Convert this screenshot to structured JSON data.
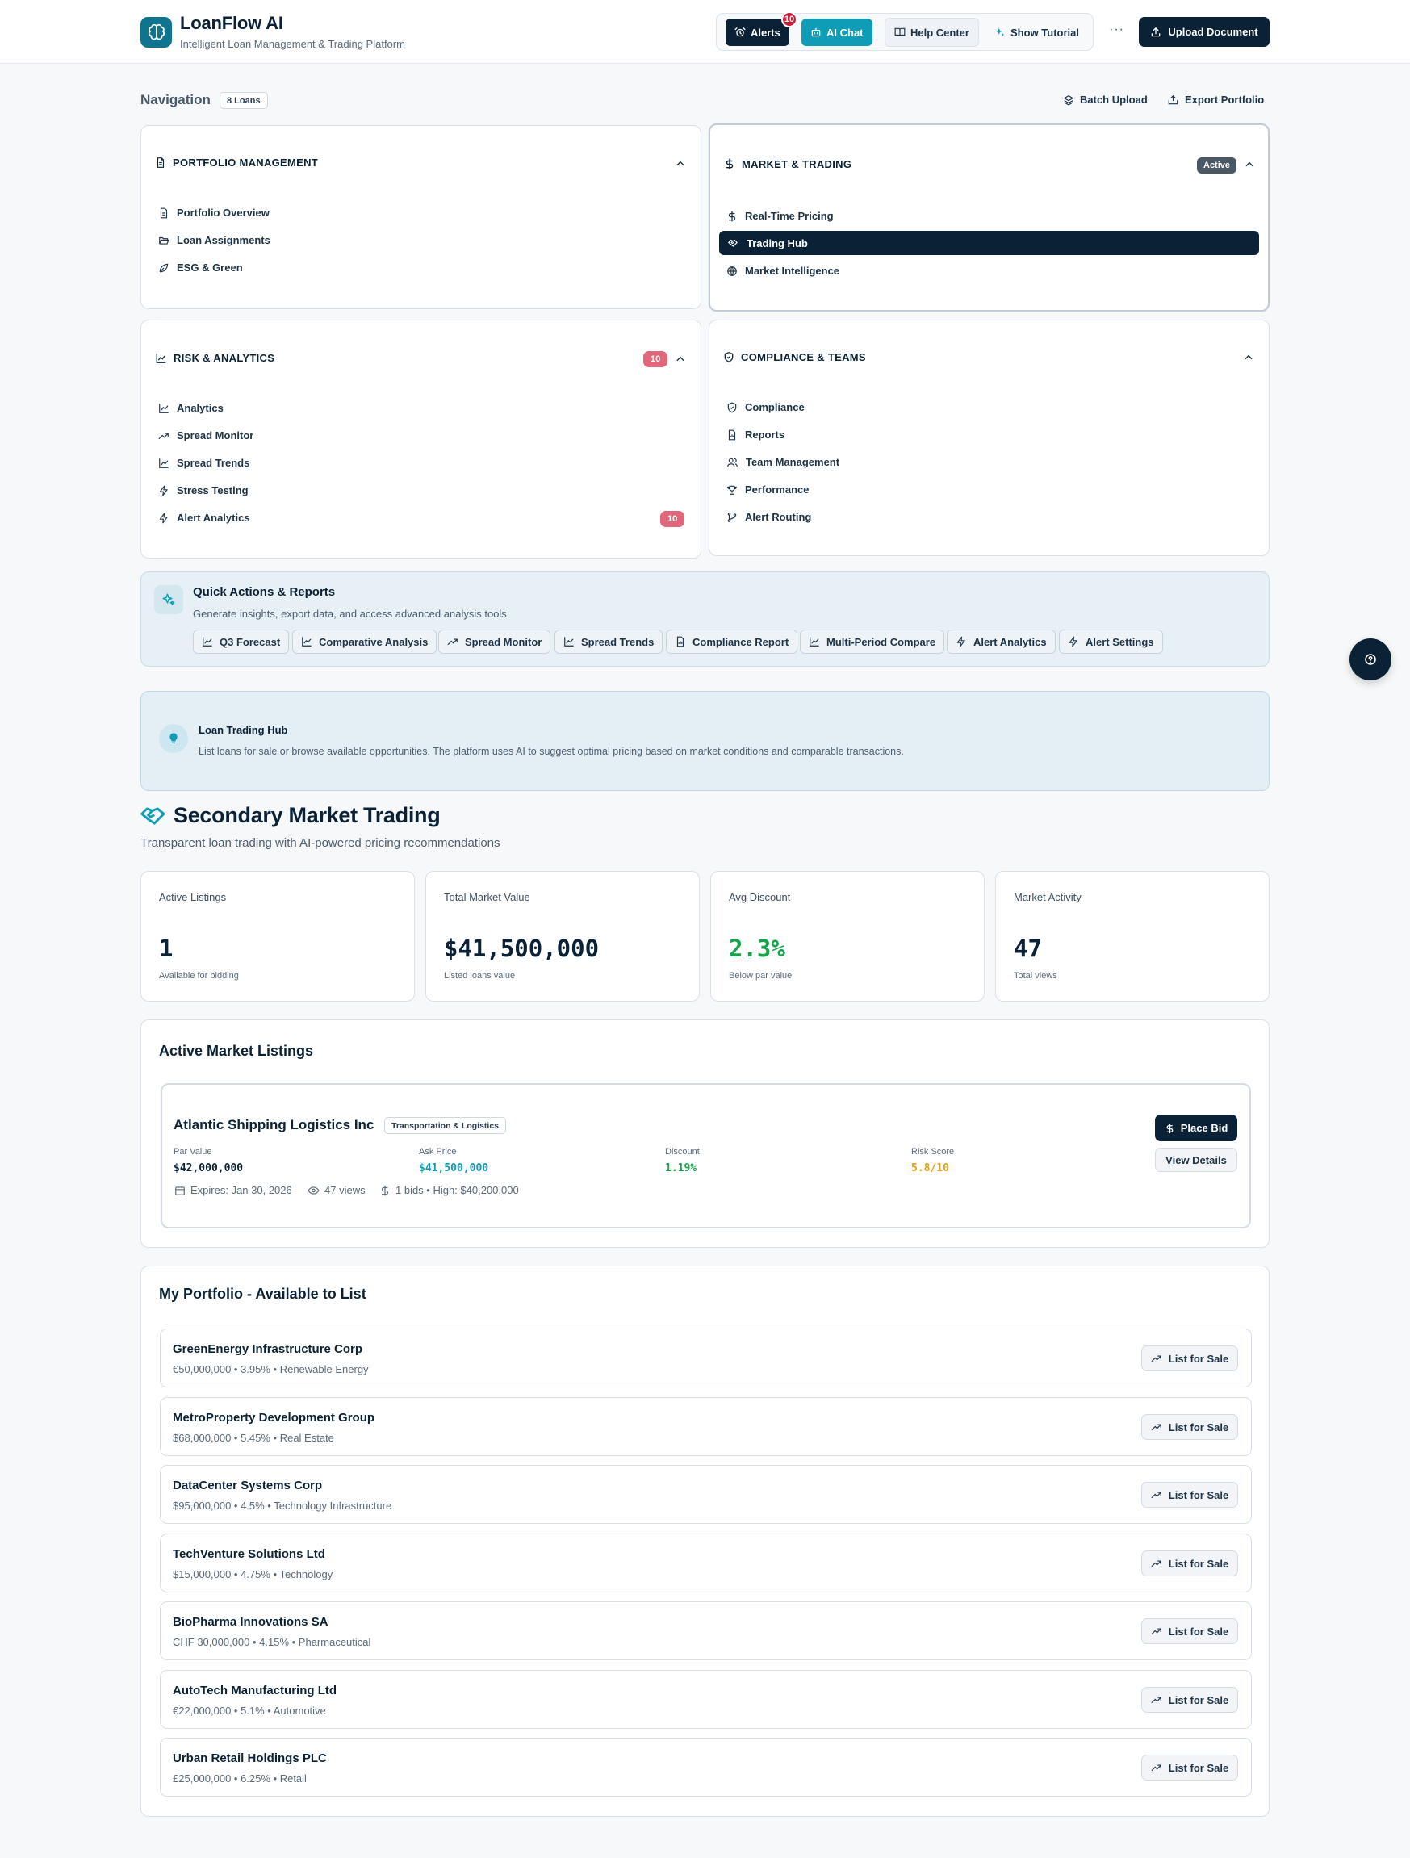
{
  "app": {
    "title": "LoanFlow AI",
    "subtitle": "Intelligent Loan Management & Trading Platform",
    "brand_color": "#0e7490",
    "dark_color": "#0b2236",
    "accent_color": "#0e9cb6"
  },
  "header": {
    "alerts_label": "Alerts",
    "alerts_badge": "10",
    "ai_chat_label": "AI Chat",
    "help_center_label": "Help Center",
    "show_tutorial_label": "Show Tutorial",
    "more_label": "···",
    "upload_label": "Upload Document"
  },
  "navigation": {
    "label": "Navigation",
    "loan_count": "8 Loans",
    "batch_upload": "Batch Upload",
    "export_portfolio": "Export Portfolio",
    "sections": {
      "portfolio": {
        "title": "PORTFOLIO MANAGEMENT",
        "items": [
          "Portfolio Overview",
          "Loan Assignments",
          "ESG & Green"
        ]
      },
      "market": {
        "title": "MARKET & TRADING",
        "badge": "Active",
        "items": [
          "Real-Time Pricing",
          "Trading Hub",
          "Market Intelligence"
        ],
        "selected": "Trading Hub"
      },
      "risk": {
        "title": "RISK & ANALYTICS",
        "badge": "10",
        "items": [
          "Analytics",
          "Spread Monitor",
          "Spread Trends",
          "Stress Testing",
          "Alert Analytics"
        ],
        "item_badge": "10"
      },
      "compliance": {
        "title": "COMPLIANCE & TEAMS",
        "items": [
          "Compliance",
          "Reports",
          "Team Management",
          "Performance",
          "Alert Routing"
        ]
      }
    }
  },
  "quick_actions": {
    "title": "Quick Actions & Reports",
    "subtitle": "Generate insights, export data, and access advanced analysis tools",
    "chips": [
      "Q3 Forecast",
      "Comparative Analysis",
      "Spread Monitor",
      "Spread Trends",
      "Compliance Report",
      "Multi-Period Compare",
      "Alert Analytics",
      "Alert Settings"
    ]
  },
  "info_banner": {
    "title": "Loan Trading Hub",
    "text": "List loans for sale or browse available opportunities. The platform uses AI to suggest optimal pricing based on market conditions and comparable transactions."
  },
  "section": {
    "title": "Secondary Market Trading",
    "subtitle": "Transparent loan trading with AI-powered pricing recommendations"
  },
  "stats": [
    {
      "label": "Active Listings",
      "value": "1",
      "foot": "Available for bidding"
    },
    {
      "label": "Total Market Value",
      "value": "$41,500,000",
      "foot": "Listed loans value"
    },
    {
      "label": "Avg Discount",
      "value": "2.3%",
      "foot": "Below par value",
      "color": "#16a34a"
    },
    {
      "label": "Market Activity",
      "value": "47",
      "foot": "Total views"
    }
  ],
  "listings": {
    "title": "Active Market Listings",
    "item": {
      "name": "Atlantic Shipping Logistics Inc",
      "tag": "Transportation & Logistics",
      "par_label": "Par Value",
      "par_value": "$42,000,000",
      "ask_label": "Ask Price",
      "ask_value": "$41,500,000",
      "discount_label": "Discount",
      "discount_value": "1.19%",
      "risk_label": "Risk Score",
      "risk_value": "5.8/10",
      "expires": "Expires: Jan 30, 2026",
      "views": "47 views",
      "bids": "1 bids • High: $40,200,000",
      "place_bid": "Place Bid",
      "view_details": "View Details"
    }
  },
  "portfolio": {
    "title": "My Portfolio - Available to List",
    "list_label": "List for Sale",
    "rows": [
      {
        "name": "GreenEnergy Infrastructure Corp",
        "detail": "€50,000,000 • 3.95% • Renewable Energy"
      },
      {
        "name": "MetroProperty Development Group",
        "detail": "$68,000,000 • 5.45% • Real Estate"
      },
      {
        "name": "DataCenter Systems Corp",
        "detail": "$95,000,000 • 4.5% • Technology Infrastructure"
      },
      {
        "name": "TechVenture Solutions Ltd",
        "detail": "$15,000,000 • 4.75% • Technology"
      },
      {
        "name": "BioPharma Innovations SA",
        "detail": "CHF 30,000,000 • 4.15% • Pharmaceutical"
      },
      {
        "name": "AutoTech Manufacturing Ltd",
        "detail": "€22,000,000 • 5.1% • Automotive"
      },
      {
        "name": "Urban Retail Holdings PLC",
        "detail": "£25,000,000 • 6.25% • Retail"
      }
    ]
  }
}
